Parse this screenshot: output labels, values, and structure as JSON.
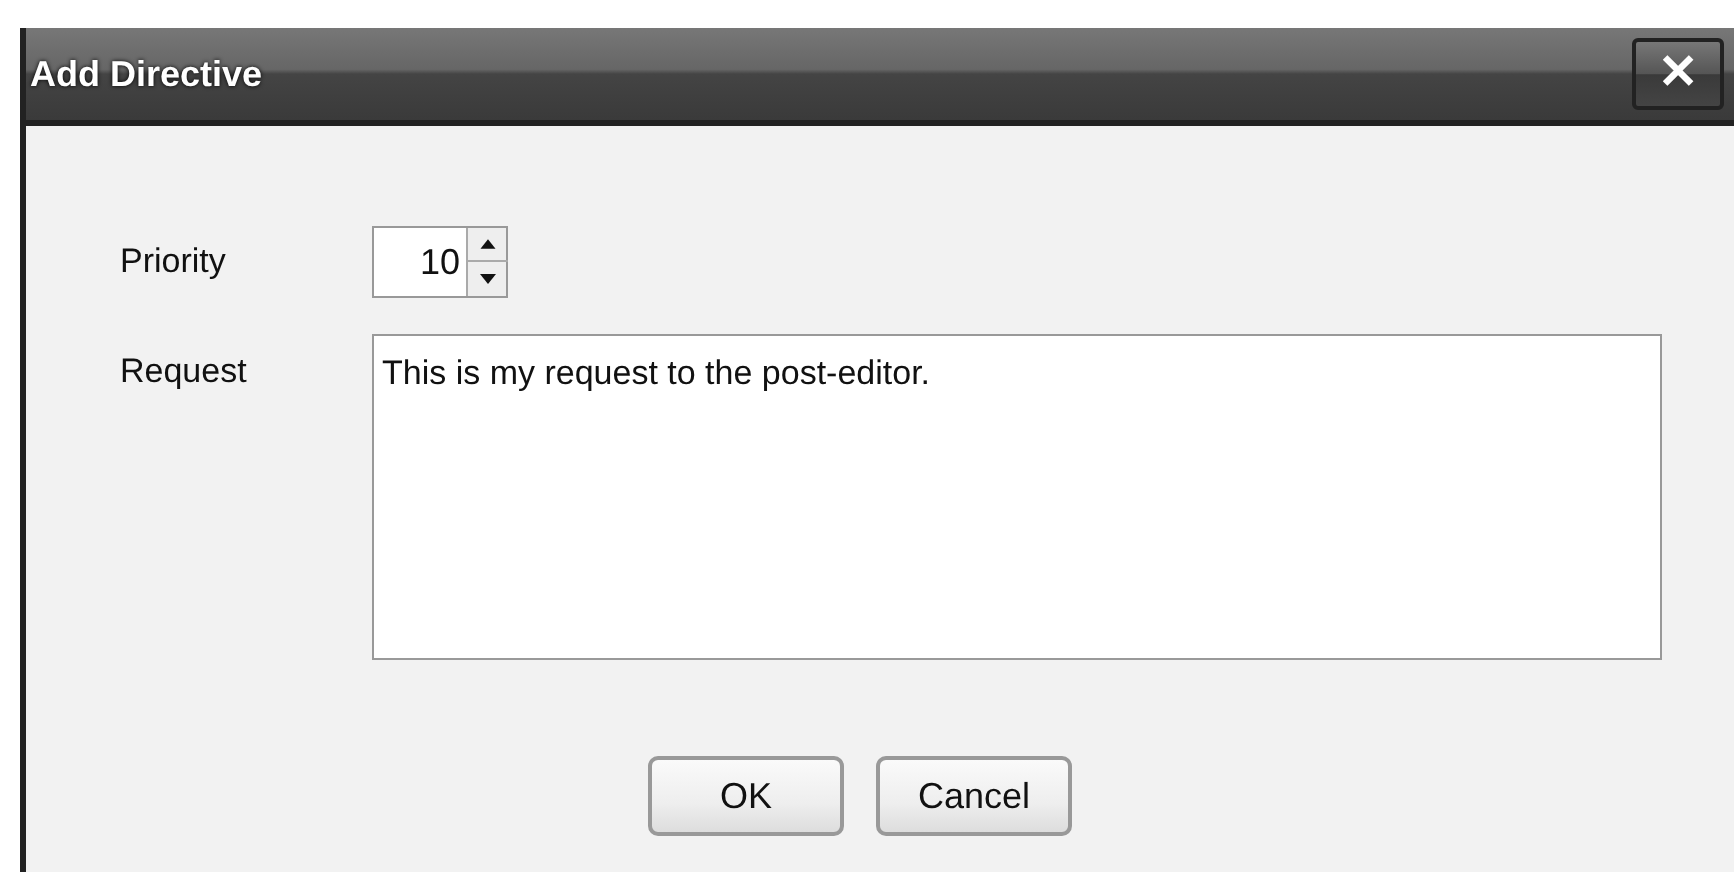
{
  "window": {
    "title": "Add Directive",
    "close": "✕"
  },
  "fields": [
    {
      "label": "Priority",
      "kind": "spinner",
      "value": "10"
    },
    {
      "label": "Request",
      "kind": "textarea",
      "value": "This is my request to the post-editor."
    }
  ],
  "buttons": [
    "OK",
    "Cancel"
  ]
}
